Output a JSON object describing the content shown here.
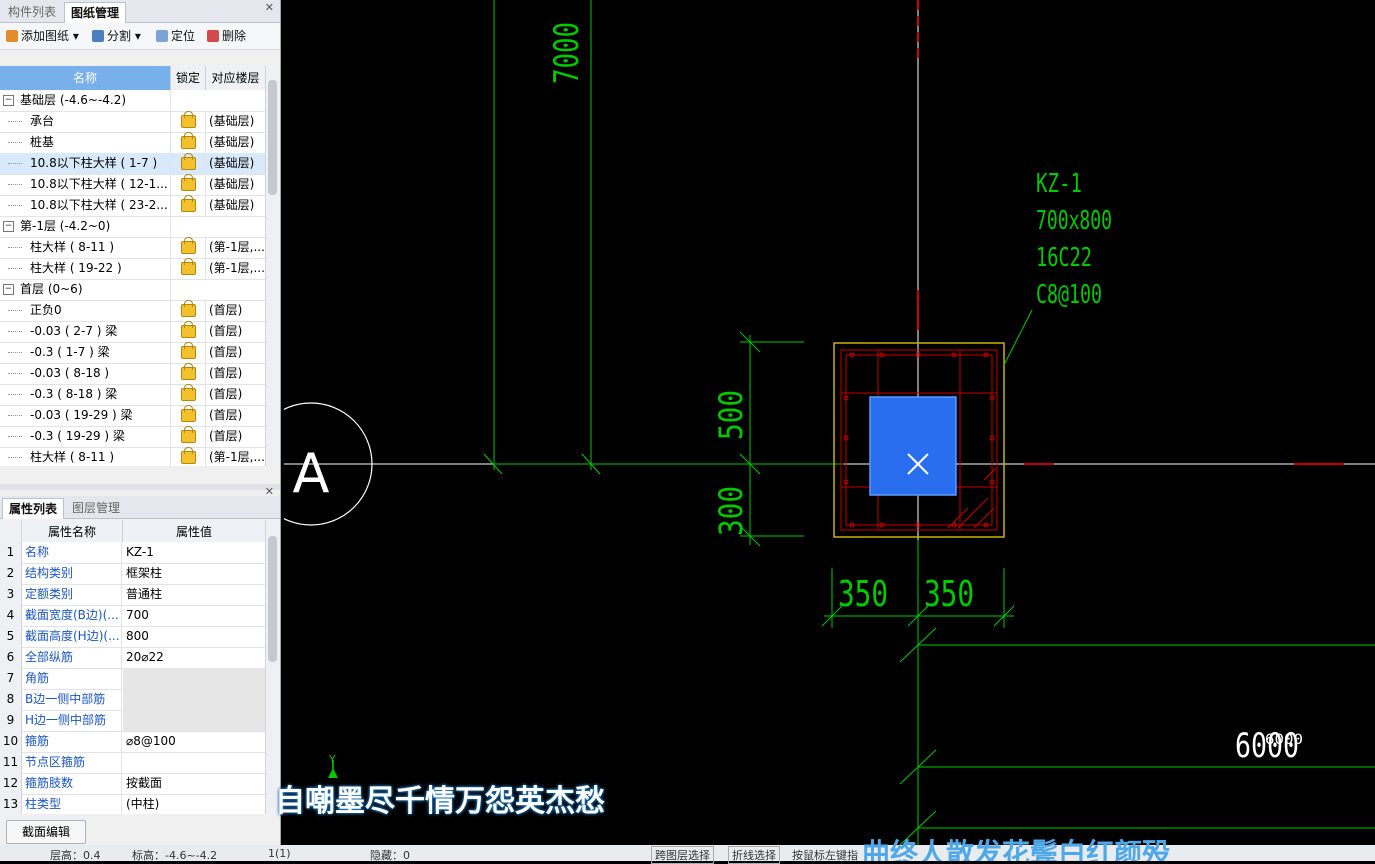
{
  "top_panel": {
    "tabs": [
      "构件列表",
      "图纸管理"
    ],
    "toolbar": {
      "add": "添加图纸",
      "split": "分割",
      "locate": "定位",
      "delete": "删除"
    },
    "columns": [
      "名称",
      "锁定",
      "对应楼层"
    ],
    "rows": [
      {
        "name": "基础层 (-4.6~-4.2)",
        "group": true,
        "floor": ""
      },
      {
        "name": "承台",
        "floor": "(基础层)"
      },
      {
        "name": "桩基",
        "floor": "(基础层)"
      },
      {
        "name": "10.8以下柱大样 ( 1-7 )",
        "floor": "(基础层)",
        "selected": true
      },
      {
        "name": "10.8以下柱大样 ( 12-1...",
        "floor": "(基础层)"
      },
      {
        "name": "10.8以下柱大样 ( 23-2...",
        "floor": "(基础层)"
      },
      {
        "name": "第-1层 (-4.2~0)",
        "group": true,
        "floor": ""
      },
      {
        "name": "柱大样 ( 8-11 )",
        "floor": "(第-1层,..."
      },
      {
        "name": "柱大样 ( 19-22 )",
        "floor": "(第-1层,..."
      },
      {
        "name": "首层 (0~6)",
        "group": true,
        "floor": ""
      },
      {
        "name": "正负0",
        "floor": "(首层)"
      },
      {
        "name": "-0.03 ( 2-7 ) 梁",
        "floor": "(首层)"
      },
      {
        "name": "-0.3 ( 1-7 ) 梁",
        "floor": "(首层)"
      },
      {
        "name": "-0.03 ( 8-18 )",
        "floor": "(首层)"
      },
      {
        "name": "-0.3 ( 8-18 ) 梁",
        "floor": "(首层)"
      },
      {
        "name": "-0.03 ( 19-29 ) 梁",
        "floor": "(首层)"
      },
      {
        "name": "-0.3 ( 19-29 ) 梁",
        "floor": "(首层)"
      },
      {
        "name": "柱大样 ( 8-11 )",
        "floor": "(第-1层,..."
      }
    ]
  },
  "bottom_panel": {
    "tabs": [
      "属性列表",
      "图层管理"
    ],
    "columns": [
      "属性名称",
      "属性值"
    ],
    "rows": [
      {
        "no": "1",
        "name": "名称",
        "value": "KZ-1"
      },
      {
        "no": "2",
        "name": "结构类别",
        "value": "框架柱"
      },
      {
        "no": "3",
        "name": "定额类别",
        "value": "普通柱"
      },
      {
        "no": "4",
        "name": "截面宽度(B边)(...",
        "value": "700"
      },
      {
        "no": "5",
        "name": "截面高度(H边)(...",
        "value": "800"
      },
      {
        "no": "6",
        "name": "全部纵筋",
        "value": "20⌀22"
      },
      {
        "no": "7",
        "name": "角筋",
        "value": "",
        "gray": true
      },
      {
        "no": "8",
        "name": "B边一侧中部筋",
        "value": "",
        "gray": true
      },
      {
        "no": "9",
        "name": "H边一侧中部筋",
        "value": "",
        "gray": true
      },
      {
        "no": "10",
        "name": "箍筋",
        "value": "⌀8@100"
      },
      {
        "no": "11",
        "name": "节点区箍筋",
        "value": ""
      },
      {
        "no": "12",
        "name": "箍筋肢数",
        "value": "按截面"
      },
      {
        "no": "13",
        "name": "柱类型",
        "value": "(中柱)"
      }
    ],
    "section_edit_button": "截面编辑"
  },
  "drawing": {
    "dim_7000": "7000",
    "axis_label": "A",
    "column_note": [
      "KZ-1",
      "700x800",
      "16C22",
      "C8@100"
    ],
    "dim_500": "500",
    "dim_300": "300",
    "dim_350_left": "350",
    "dim_350_right": "350",
    "dim_6000": "6000",
    "dim_6000_small": "6000",
    "ucs_y": "Y",
    "colors": {
      "background": "#000000",
      "green": "#00cc00",
      "red": "#cc0000",
      "yellow": "#c8b400",
      "white": "#ffffff",
      "blue": "#2a6ef0"
    }
  },
  "subtitles": {
    "line1": "自嘲墨尽千情万怨英杰愁",
    "line2": "曲终人散发花鬓白红颜殁"
  },
  "status_bar": {
    "floor": "层高：0.4",
    "elev": "标高：-4.6~-4.2",
    "count": "1(1)",
    "hidden": "隐藏：0",
    "cross_select": "跨图层选择",
    "poly_select": "折线选择",
    "hint": "按鼠标左键指"
  }
}
